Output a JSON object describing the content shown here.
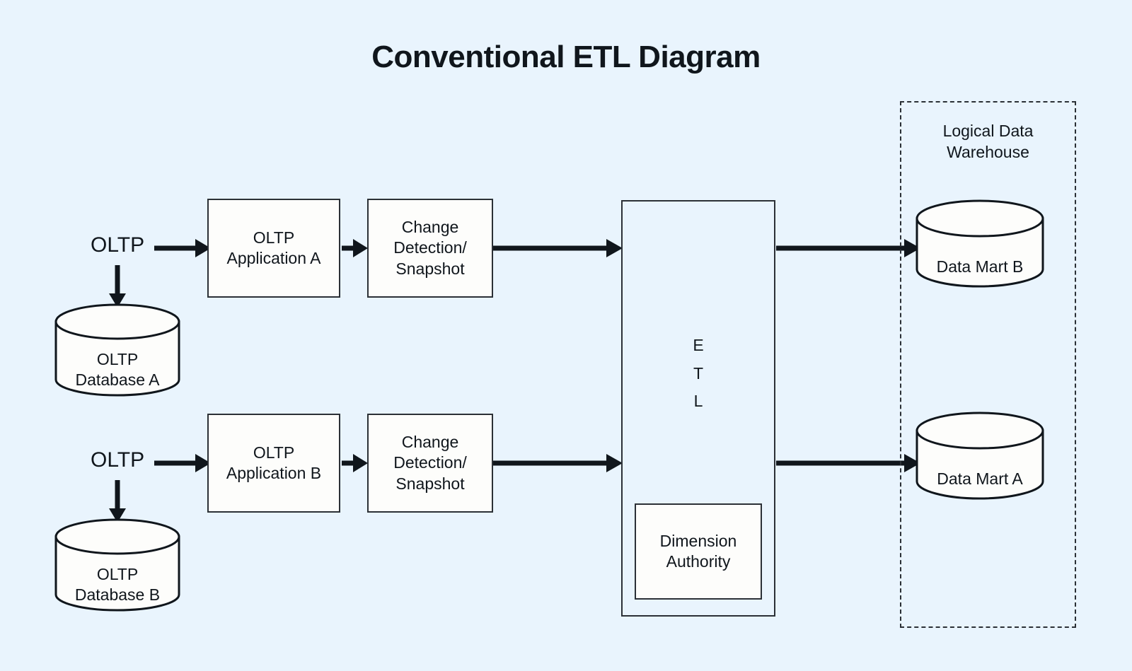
{
  "page": {
    "title": "Conventional ETL Diagram",
    "background_color": "#e9f4fd",
    "stroke_color": "#2b3036",
    "node_fill_color": "#fdfdfb",
    "text_color": "#10161c"
  },
  "nodes": {
    "oltp_label_top": "OLTP",
    "oltp_label_bottom": "OLTP",
    "oltp_db_a": "OLTP\nDatabase A",
    "oltp_db_a_line1": "OLTP",
    "oltp_db_a_line2": "Database A",
    "oltp_db_b_line1": "OLTP",
    "oltp_db_b_line2": "Database B",
    "oltp_app_a_line1": "OLTP",
    "oltp_app_a_line2": "Application A",
    "oltp_app_b_line1": "OLTP",
    "oltp_app_b_line2": "Application B",
    "change_detect_a_line1": "Change",
    "change_detect_a_line2": "Detection/",
    "change_detect_a_line3": "Snapshot",
    "change_detect_b_line1": "Change",
    "change_detect_b_line2": "Detection/",
    "change_detect_b_line3": "Snapshot",
    "etl_line1": "E",
    "etl_line2": "T",
    "etl_line3": "L",
    "dimension_authority_line1": "Dimension",
    "dimension_authority_line2": "Authority",
    "logical_dw_line1": "Logical Data",
    "logical_dw_line2": "Warehouse",
    "data_mart_b": "Data Mart B",
    "data_mart_a": "Data Mart A"
  },
  "flow": {
    "edges": [
      {
        "from": "oltp_label_top",
        "to": "oltp_app_a",
        "direction": "right"
      },
      {
        "from": "oltp_label_top",
        "to": "oltp_db_a",
        "direction": "down"
      },
      {
        "from": "oltp_app_a",
        "to": "change_detect_a",
        "direction": "right"
      },
      {
        "from": "change_detect_a",
        "to": "etl",
        "direction": "right"
      },
      {
        "from": "oltp_label_bottom",
        "to": "oltp_app_b",
        "direction": "right"
      },
      {
        "from": "oltp_label_bottom",
        "to": "oltp_db_b",
        "direction": "down"
      },
      {
        "from": "oltp_app_b",
        "to": "change_detect_b",
        "direction": "right"
      },
      {
        "from": "change_detect_b",
        "to": "etl",
        "direction": "right"
      },
      {
        "from": "etl",
        "to": "data_mart_b",
        "direction": "right"
      },
      {
        "from": "etl",
        "to": "data_mart_a",
        "direction": "right"
      }
    ]
  }
}
